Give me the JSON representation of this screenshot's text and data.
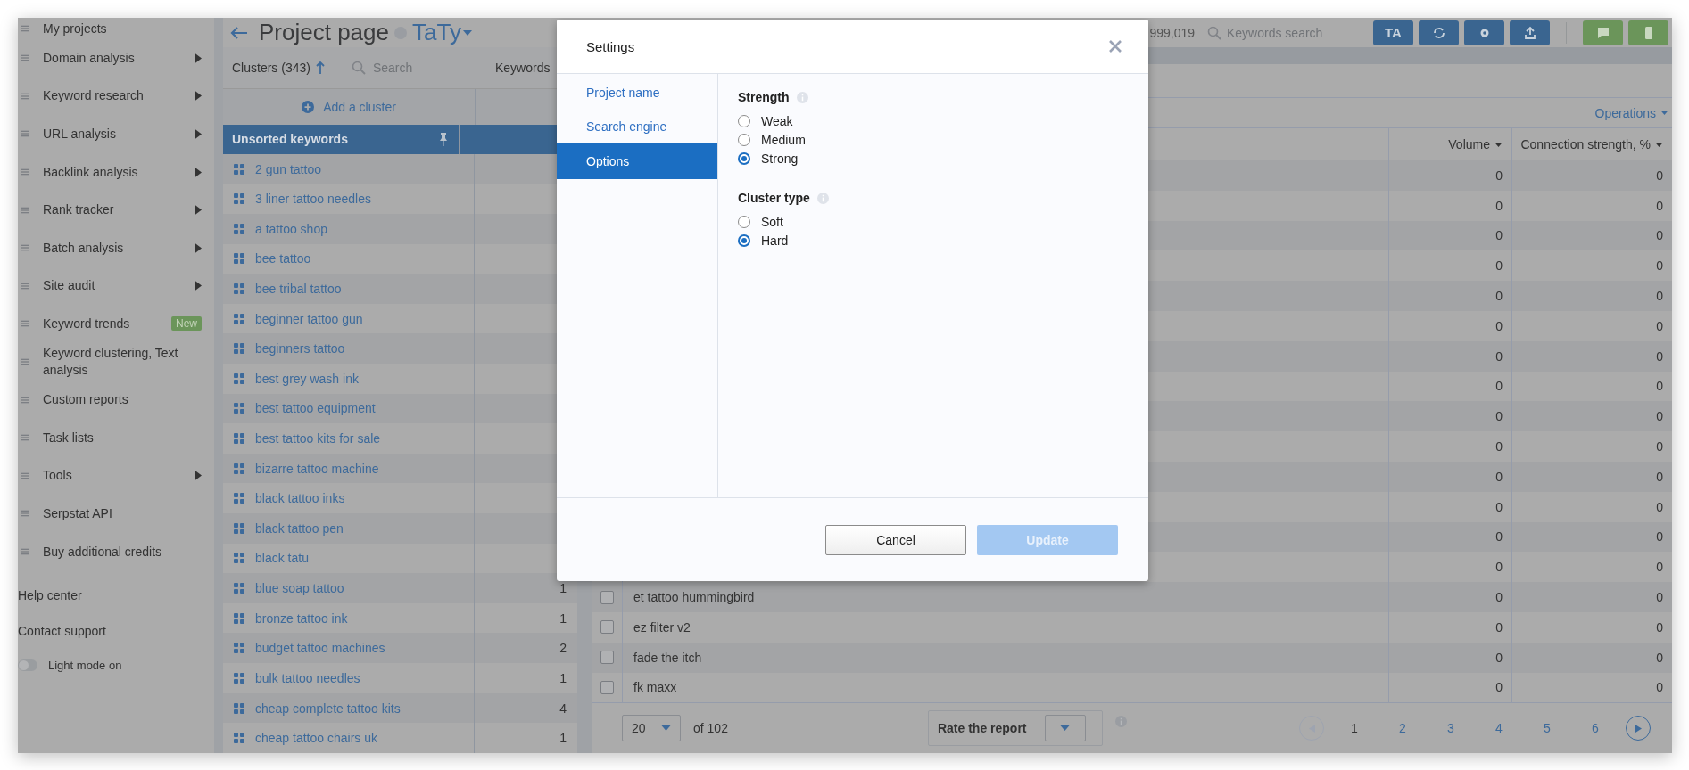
{
  "sidebar": {
    "items": [
      {
        "label": "My projects",
        "submenu": false
      },
      {
        "label": "Domain analysis",
        "submenu": true
      },
      {
        "label": "Keyword research",
        "submenu": true
      },
      {
        "label": "URL analysis",
        "submenu": true
      },
      {
        "label": "Backlink analysis",
        "submenu": true
      },
      {
        "label": "Rank tracker",
        "submenu": true
      },
      {
        "label": "Batch analysis",
        "submenu": true
      },
      {
        "label": "Site audit",
        "submenu": true
      },
      {
        "label": "Keyword trends",
        "submenu": false,
        "badge": "New"
      },
      {
        "label": "Keyword clustering, Text analysis",
        "submenu": false
      },
      {
        "label": "Custom reports",
        "submenu": false
      },
      {
        "label": "Task lists",
        "submenu": false
      },
      {
        "label": "Tools",
        "submenu": true
      },
      {
        "label": "Serpstat API",
        "submenu": false
      },
      {
        "label": "Buy additional credits",
        "submenu": false
      }
    ],
    "links": [
      "Help center",
      "Contact support"
    ],
    "theme_toggle": {
      "label": "Light mode on",
      "on": false
    }
  },
  "header": {
    "title": "Project page",
    "project": "TaTy",
    "credits": "999,019",
    "search": {
      "placeholder": "Keywords search"
    },
    "buttons": [
      {
        "kind": "text",
        "label": "TA",
        "color": "#3a6590"
      },
      {
        "kind": "refresh",
        "color": "#3a6590"
      },
      {
        "kind": "settings",
        "color": "#3a6590"
      },
      {
        "kind": "export",
        "color": "#3a6590"
      },
      {
        "kind": "comment",
        "color": "#6b955a"
      },
      {
        "kind": "phone",
        "color": "#6b955a"
      }
    ]
  },
  "clusters": {
    "title": "Clusters (343)",
    "search": {
      "placeholder": "Search"
    },
    "count_header": "Keywords",
    "add_label": "Add a cluster",
    "pinned": {
      "name": "Unsorted keywords"
    },
    "items": [
      {
        "name": "2 gun tattoo"
      },
      {
        "name": "3 liner tattoo needles"
      },
      {
        "name": "a tattoo shop"
      },
      {
        "name": "bee tattoo"
      },
      {
        "name": "bee tribal tattoo"
      },
      {
        "name": "beginner tattoo gun"
      },
      {
        "name": "beginners tattoo"
      },
      {
        "name": "best grey wash ink"
      },
      {
        "name": "best tattoo equipment"
      },
      {
        "name": "best tattoo kits for sale"
      },
      {
        "name": "bizarre tattoo machine"
      },
      {
        "name": "black tattoo inks"
      },
      {
        "name": "black tattoo pen"
      },
      {
        "name": "black tatu"
      },
      {
        "name": "blue soap tattoo",
        "count": "1"
      },
      {
        "name": "bronze tattoo ink",
        "count": "1"
      },
      {
        "name": "budget tattoo machines",
        "count": "2"
      },
      {
        "name": "bulk tattoo needles",
        "count": "1"
      },
      {
        "name": "cheap complete tattoo kits",
        "count": "4"
      },
      {
        "name": "cheap tattoo chairs uk",
        "count": "1"
      }
    ]
  },
  "table": {
    "operations": "Operations",
    "columns": [
      "Volume",
      "Connection strength, %"
    ],
    "rows": [
      {
        "volume": "0",
        "strength": "0"
      },
      {
        "volume": "0",
        "strength": "0"
      },
      {
        "volume": "0",
        "strength": "0"
      },
      {
        "volume": "0",
        "strength": "0"
      },
      {
        "volume": "0",
        "strength": "0"
      },
      {
        "volume": "0",
        "strength": "0"
      },
      {
        "volume": "0",
        "strength": "0"
      },
      {
        "volume": "0",
        "strength": "0"
      },
      {
        "volume": "0",
        "strength": "0"
      },
      {
        "volume": "0",
        "strength": "0"
      },
      {
        "volume": "0",
        "strength": "0"
      },
      {
        "volume": "0",
        "strength": "0"
      },
      {
        "volume": "0",
        "strength": "0"
      },
      {
        "volume": "0",
        "strength": "0"
      },
      {
        "keyword": "et tattoo hummingbird",
        "checked": false,
        "volume": "0",
        "strength": "0"
      },
      {
        "keyword": "ez filter v2",
        "checked": false,
        "volume": "0",
        "strength": "0"
      },
      {
        "keyword": "fade the itch",
        "checked": false,
        "volume": "0",
        "strength": "0"
      },
      {
        "keyword": "fk maxx",
        "checked": false,
        "volume": "0",
        "strength": "0"
      }
    ],
    "pagination": {
      "page_size": "20",
      "total": "of 102",
      "rate_label": "Rate the report",
      "prev_disabled": true,
      "pages": [
        {
          "label": "1",
          "selected": true
        },
        {
          "label": "2",
          "selected": false
        },
        {
          "label": "3",
          "selected": false
        },
        {
          "label": "4",
          "selected": false
        },
        {
          "label": "5",
          "selected": false
        },
        {
          "label": "6",
          "selected": false
        }
      ]
    }
  },
  "modal": {
    "title": "Settings",
    "nav": [
      {
        "label": "Project name",
        "selected": false
      },
      {
        "label": "Search engine",
        "selected": false
      },
      {
        "label": "Options",
        "selected": true
      }
    ],
    "groups": [
      {
        "title": "Strength",
        "options": [
          {
            "label": "Weak",
            "selected": false
          },
          {
            "label": "Medium",
            "selected": false
          },
          {
            "label": "Strong",
            "selected": true
          }
        ]
      },
      {
        "title": "Cluster type",
        "options": [
          {
            "label": "Soft",
            "selected": false
          },
          {
            "label": "Hard",
            "selected": true
          }
        ]
      }
    ],
    "cancel": "Cancel",
    "update": "Update",
    "update_disabled": true
  }
}
